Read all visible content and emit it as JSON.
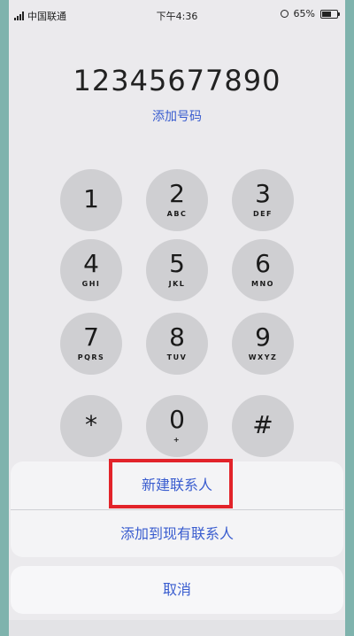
{
  "status_bar": {
    "carrier": "中国联通",
    "time": "下午4:36",
    "battery": "65%",
    "battery_level": 0.65
  },
  "dialer": {
    "number": "12345677890",
    "add_number_label": "添加号码",
    "keys": [
      {
        "digit": "1",
        "letters": ""
      },
      {
        "digit": "2",
        "letters": "ABC"
      },
      {
        "digit": "3",
        "letters": "DEF"
      },
      {
        "digit": "4",
        "letters": "GHI"
      },
      {
        "digit": "5",
        "letters": "JKL"
      },
      {
        "digit": "6",
        "letters": "MNO"
      },
      {
        "digit": "7",
        "letters": "PQRS"
      },
      {
        "digit": "8",
        "letters": "TUV"
      },
      {
        "digit": "9",
        "letters": "WXYZ"
      },
      {
        "digit": "*",
        "letters": ""
      },
      {
        "digit": "0",
        "letters": "+"
      },
      {
        "digit": "#",
        "letters": ""
      }
    ]
  },
  "action_sheet": {
    "create_contact": "新建联系人",
    "add_to_existing": "添加到现有联系人",
    "cancel": "取消"
  },
  "colors": {
    "accent": "#3a5dcf",
    "highlight": "#e2232a"
  }
}
